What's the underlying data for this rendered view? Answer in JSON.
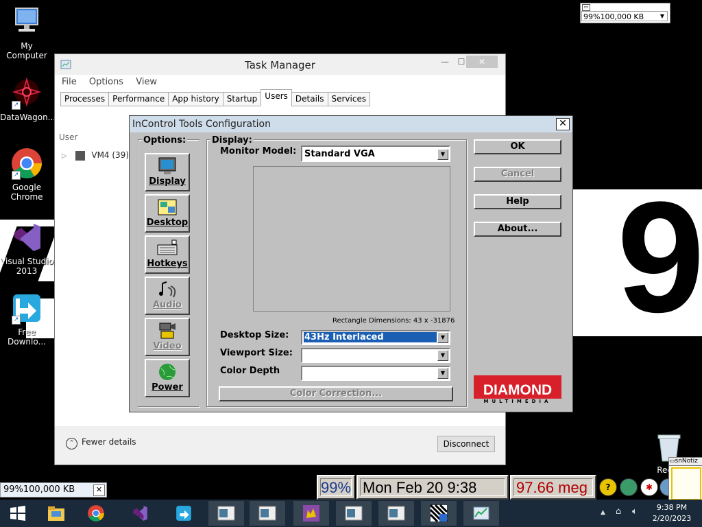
{
  "desktop": {
    "icons": [
      {
        "label": "My Computer"
      },
      {
        "label": "DataWagon..."
      },
      {
        "label": "Google Chrome"
      },
      {
        "label": "Visual Studio 2013"
      },
      {
        "label": "Free Downlo..."
      }
    ],
    "recycle_label": "Recyc",
    "big_digit": "9"
  },
  "top_right_widget": {
    "value": "99%100,000 KB"
  },
  "task_manager": {
    "title": "Task Manager",
    "menu": [
      "File",
      "Options",
      "View"
    ],
    "tabs": [
      "Processes",
      "Performance",
      "App history",
      "Startup",
      "Users",
      "Details",
      "Services"
    ],
    "active_tab": "Users",
    "column_user": "User",
    "row_user": "VM4 (39)",
    "fewer_details": "Fewer details",
    "disconnect": "Disconnect"
  },
  "incontrol": {
    "title": "InControl Tools Configuration",
    "options_label": "Options:",
    "display_label": "Display:",
    "options": [
      {
        "label": "Display",
        "enabled": true,
        "icon": "monitor-icon"
      },
      {
        "label": "Desktop",
        "enabled": true,
        "icon": "desktop-icon"
      },
      {
        "label": "Hotkeys",
        "enabled": true,
        "icon": "keyboard-icon"
      },
      {
        "label": "Audio",
        "enabled": false,
        "icon": "audio-icon"
      },
      {
        "label": "Video",
        "enabled": false,
        "icon": "video-camera-icon"
      },
      {
        "label": "Power",
        "enabled": true,
        "icon": "globe-icon"
      }
    ],
    "monitor_model_label": "Monitor Model:",
    "monitor_model_value": "Standard VGA",
    "rectangle_dimensions": "Rectangle Dimensions:  43 x -31876",
    "desktop_size_label": "Desktop Size:",
    "desktop_size_value": "43Hz Interlaced",
    "viewport_size_label": "Viewport Size:",
    "viewport_size_value": "",
    "color_depth_label": "Color Depth",
    "color_depth_value": "",
    "color_correction": "Color Correction...",
    "buttons": {
      "ok": "OK",
      "cancel": "Cancel",
      "help": "Help",
      "about": "About..."
    },
    "brand": "DIAMOND",
    "brand_sub": "MULTIMEDIA"
  },
  "bottom_left_field": {
    "value": "99%100,000 KB"
  },
  "status": {
    "percent": "99%",
    "datetime": "Mon Feb 20 9:38",
    "memory": "97.66 meg"
  },
  "notiz": {
    "title": "snNotiz"
  },
  "taskbar": {
    "time": "9:38 PM",
    "date": "2/20/2023",
    "tray_up": "▲"
  },
  "colors": {
    "taskbar": "#1b2a3a",
    "dialog_gray": "#c0c0c0",
    "selection": "#1a5fb4",
    "status_blue": "#1a3a8a",
    "status_red": "#b00000",
    "diamond_red": "#d8202a"
  }
}
